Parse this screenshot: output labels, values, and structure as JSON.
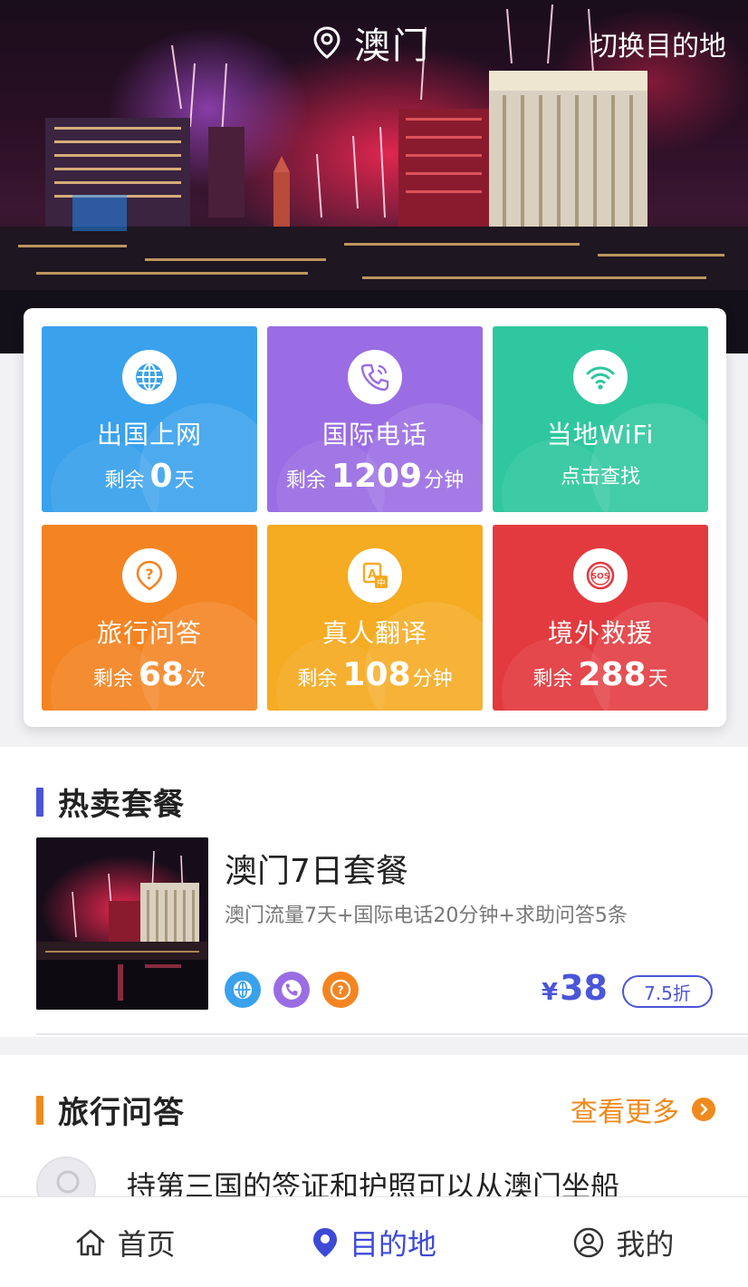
{
  "header": {
    "location": "澳门",
    "switch_label": "切换目的地"
  },
  "services": [
    {
      "title": "出国上网",
      "prefix": "剩余",
      "value": "0",
      "unit": "天",
      "icon": "globe-icon",
      "color": "#3aa1ec"
    },
    {
      "title": "国际电话",
      "prefix": "剩余",
      "value": "1209",
      "unit": "分钟",
      "icon": "phone-icon",
      "color": "#9a6de4"
    },
    {
      "title": "当地WiFi",
      "sub": "点击查找",
      "icon": "wifi-icon",
      "color": "#2fc79f"
    },
    {
      "title": "旅行问答",
      "prefix": "剩余",
      "value": "68",
      "unit": "次",
      "icon": "question-pin-icon",
      "color": "#f48422"
    },
    {
      "title": "真人翻译",
      "prefix": "剩余",
      "value": "108",
      "unit": "分钟",
      "icon": "translate-icon",
      "color": "#f5ab22"
    },
    {
      "title": "境外救援",
      "prefix": "剩余",
      "value": "288",
      "unit": "天",
      "icon": "sos-icon",
      "color": "#e23a3f"
    }
  ],
  "hot": {
    "section_title": "热卖套餐",
    "package": {
      "title": "澳门7日套餐",
      "desc": "澳门流量7天+国际电话20分钟+求助问答5条",
      "currency": "¥",
      "price": "38",
      "discount": "7.5折",
      "icons": [
        "globe-icon",
        "phone-icon",
        "question-icon"
      ]
    }
  },
  "qa": {
    "section_title": "旅行问答",
    "more_label": "查看更多",
    "first_question": "持第三国的签证和护照可以从澳门坐船"
  },
  "tabs": [
    {
      "label": "首页",
      "icon": "home-icon",
      "active": false
    },
    {
      "label": "目的地",
      "icon": "location-pin-icon",
      "active": true
    },
    {
      "label": "我的",
      "icon": "user-icon",
      "active": false
    }
  ],
  "colors": {
    "accent": "#3d4ad6",
    "orange": "#f08a1d"
  }
}
